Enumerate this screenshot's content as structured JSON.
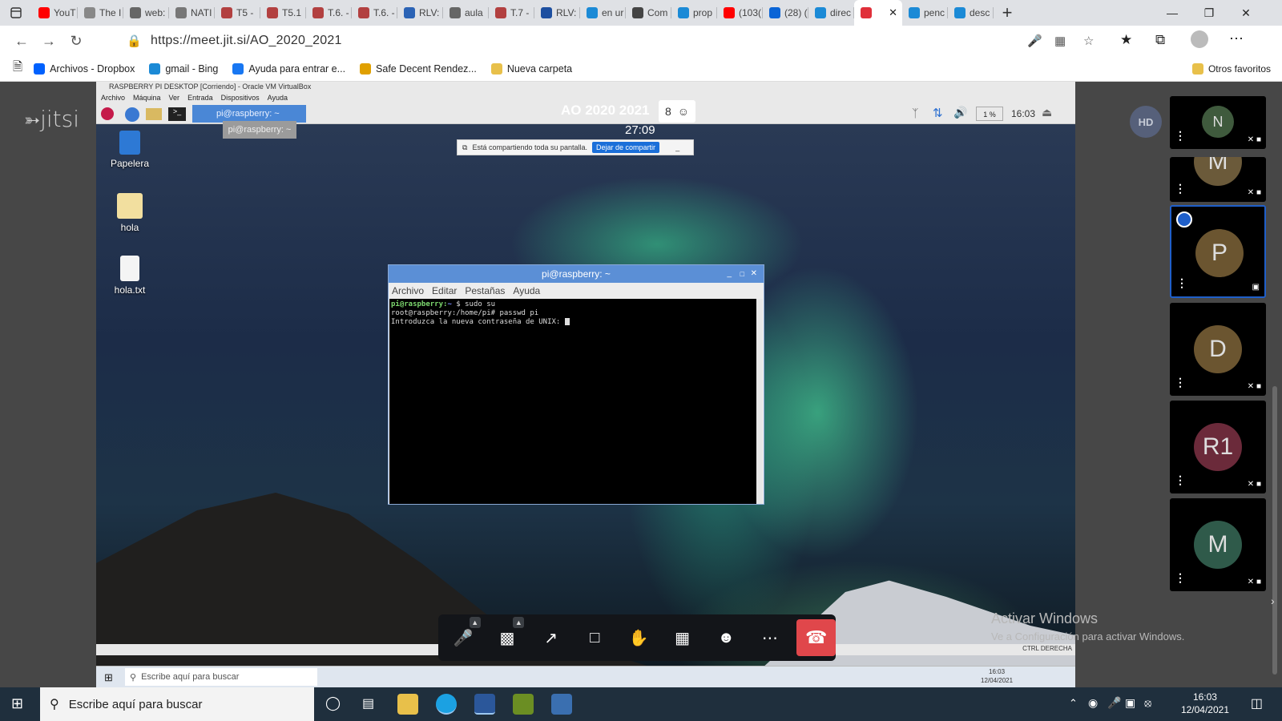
{
  "browser": {
    "tabs": [
      {
        "label": "YouT",
        "color": "#ff0000"
      },
      {
        "label": "The I",
        "color": "#888888"
      },
      {
        "label": "web:",
        "color": "#666666"
      },
      {
        "label": "NATI",
        "color": "#777777"
      },
      {
        "label": "T5 -",
        "color": "#b24040"
      },
      {
        "label": "T5.1",
        "color": "#b24040"
      },
      {
        "label": "T.6. -",
        "color": "#b24040"
      },
      {
        "label": "T.6. -",
        "color": "#b24040"
      },
      {
        "label": "RLV:",
        "color": "#2b63b5"
      },
      {
        "label": "aula",
        "color": "#666666"
      },
      {
        "label": "T.7 -",
        "color": "#b24040"
      },
      {
        "label": "RLV:",
        "color": "#1d4fa0"
      },
      {
        "label": "en ur",
        "color": "#1b8ad6"
      },
      {
        "label": "Com",
        "color": "#444444"
      },
      {
        "label": "prop",
        "color": "#1b8ad6"
      },
      {
        "label": "(103(",
        "color": "#ff0000"
      },
      {
        "label": "(28) (",
        "color": "#0a64d6"
      },
      {
        "label": "direc",
        "color": "#1b8ad6"
      },
      {
        "label": "",
        "color": "#e0303a",
        "active": true
      },
      {
        "label": "penc",
        "color": "#1b8ad6"
      },
      {
        "label": "desc",
        "color": "#1b8ad6"
      }
    ],
    "url": "https://meet.jit.si/AO_2020_2021",
    "bookmarks": [
      {
        "label": "Archivos - Dropbox",
        "color": "#0061fe"
      },
      {
        "label": "gmail - Bing",
        "color": "#1b8ad6"
      },
      {
        "label": "Ayuda para entrar e...",
        "color": "#1877f2"
      },
      {
        "label": "Safe Decent Rendez...",
        "color": "#e0a000"
      },
      {
        "label": "Nueva carpeta",
        "color": "#e8c04a"
      }
    ],
    "other_favorites": "Otros favoritos"
  },
  "meeting": {
    "logo": "jitsi",
    "quality_badge": "HD",
    "title": "AO 2020 2021",
    "timer": "27:09",
    "participant_count": "8",
    "share_notice": "Está compartiendo toda su pantalla.",
    "stop_share": "Dejar de compartir",
    "watermark_title": "Activar Windows",
    "watermark_sub": "Ve a Configuración para activar Windows.",
    "participants": [
      {
        "initial": "N",
        "color": "#3f5a3d"
      },
      {
        "initial": "M",
        "color": "#6b5a3a"
      },
      {
        "initial": "P",
        "color": "#6b5530",
        "active": true
      },
      {
        "initial": "D",
        "color": "#6b5530"
      },
      {
        "initial": "R1",
        "color": "#6b2a3a"
      },
      {
        "initial": "M",
        "color": "#2f5a4a"
      }
    ]
  },
  "vm": {
    "window_title": "RASPBERRY PI DESKTOP [Corriendo] - Oracle VM VirtualBox",
    "menu": [
      "Archivo",
      "Máquina",
      "Ver",
      "Entrada",
      "Dispositivos",
      "Ayuda"
    ],
    "taskbar_item": "pi@raspberry: ~",
    "tooltip": "pi@raspberry: ~",
    "clock": "16:03",
    "cpu": "1 %",
    "desktop_icons": [
      {
        "label": "Papelera"
      },
      {
        "label": "hola"
      },
      {
        "label": "hola.txt"
      }
    ],
    "terminal": {
      "title": "pi@raspberry: ~",
      "menu": [
        "Archivo",
        "Editar",
        "Pestañas",
        "Ayuda"
      ],
      "lines": [
        "pi@raspberry:~ $ sudo su",
        "root@raspberry:/home/pi# passwd pi",
        "Introduzca la nueva contraseña de UNIX: "
      ]
    },
    "host_search": "Escribe aquí para buscar",
    "host_clock": "16:03",
    "host_date": "12/04/2021",
    "ctrl_label": "CTRL DERECHA"
  },
  "windows": {
    "search_placeholder": "Escribe aquí para buscar",
    "time": "16:03",
    "date": "12/04/2021"
  }
}
